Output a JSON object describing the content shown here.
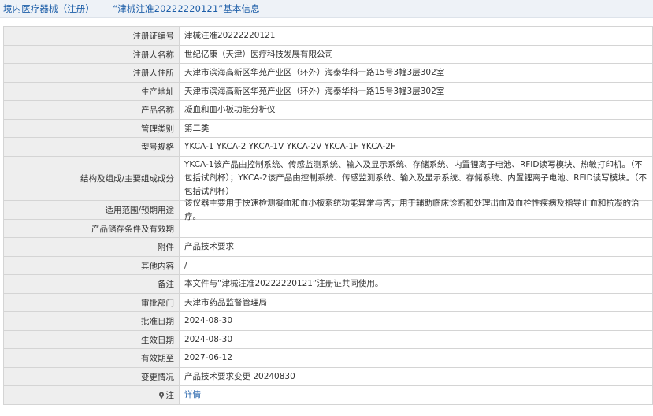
{
  "header": {
    "title": "境内医疗器械（注册）——“津械注准20222220121”基本信息"
  },
  "rows": [
    {
      "label": "注册证编号",
      "value": "津械注准20222220121"
    },
    {
      "label": "注册人名称",
      "value": "世纪亿康（天津）医疗科技发展有限公司"
    },
    {
      "label": "注册人住所",
      "value": "天津市滨海高新区华苑产业区（环外）海泰华科一路15号3幢3层302室"
    },
    {
      "label": "生产地址",
      "value": "天津市滨海高新区华苑产业区（环外）海泰华科一路15号3幢3层302室"
    },
    {
      "label": "产品名称",
      "value": "凝血和血小板功能分析仪"
    },
    {
      "label": "管理类别",
      "value": "第二类"
    },
    {
      "label": "型号规格",
      "value": "YKCA-1 YKCA-2 YKCA-1V YKCA-2V YKCA-1F YKCA-2F"
    },
    {
      "label": "结构及组成/主要组成成分",
      "value": "YKCA-1该产品由控制系统、传感监测系统、输入及显示系统、存储系统、内置锂离子电池、RFID读写模块、热敏打印机。（不包括试剂杯）；YKCA-2该产品由控制系统、传感监测系统、输入及显示系统、存储系统、内置锂离子电池、RFID读写模块。（不包括试剂杯）"
    },
    {
      "label": "适用范围/预期用途",
      "value": "该仪器主要用于快速检测凝血和血小板系统功能异常与否，用于辅助临床诊断和处理出血及血栓性疾病及指导止血和抗凝的治疗。"
    },
    {
      "label": "产品储存条件及有效期",
      "value": ""
    },
    {
      "label": "附件",
      "value": "产品技术要求"
    },
    {
      "label": "其他内容",
      "value": "/"
    },
    {
      "label": "备注",
      "value": "本文件与“津械注准20222220121”注册证共同使用。"
    },
    {
      "label": "审批部门",
      "value": "天津市药品监督管理局"
    },
    {
      "label": "批准日期",
      "value": "2024-08-30"
    },
    {
      "label": "生效日期",
      "value": "2024-08-30"
    },
    {
      "label": "有效期至",
      "value": "2027-06-12"
    },
    {
      "label": "变更情况",
      "value": "产品技术要求变更 20240830"
    }
  ],
  "note_row": {
    "icon": "pin-icon",
    "label": "注",
    "link": "详情"
  },
  "colors": {
    "title_text": "#1d5ea8",
    "label_bg": "#eeeeee",
    "border": "#d4d4d4",
    "link": "#1d5ea8"
  }
}
